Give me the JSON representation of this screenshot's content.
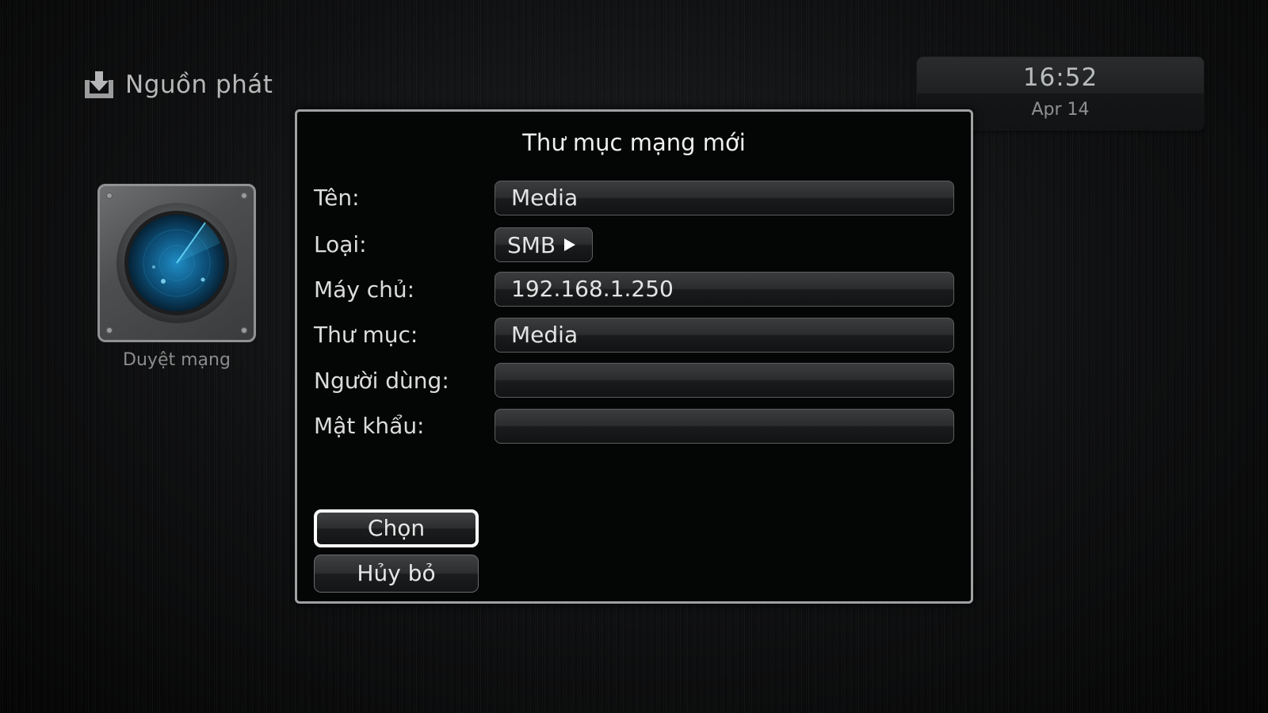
{
  "header": {
    "title": "Nguồn phát",
    "icon": "download-tray-icon"
  },
  "clock": {
    "time": "16:52",
    "date": "Apr 14"
  },
  "browse_tile": {
    "label": "Duyệt mạng",
    "icon": "radar-icon"
  },
  "dialog": {
    "title": "Thư mục mạng mới",
    "fields": {
      "name": {
        "label": "Tên:",
        "value": "Media"
      },
      "type": {
        "label": "Loại:",
        "value": "SMB",
        "icon": "play-arrow-icon"
      },
      "server": {
        "label": "Máy chủ:",
        "value": "192.168.1.250"
      },
      "folder": {
        "label": "Thư mục:",
        "value": "Media"
      },
      "user": {
        "label": "Người dùng:",
        "value": ""
      },
      "password": {
        "label": "Mật khẩu:",
        "value": ""
      }
    },
    "buttons": {
      "select": "Chọn",
      "cancel": "Hủy bỏ"
    }
  },
  "colors": {
    "background": "#070808",
    "dialog_border": "#9fa1a3",
    "focus_border": "#ffffff",
    "radar_glow": "#1fa3d8"
  }
}
